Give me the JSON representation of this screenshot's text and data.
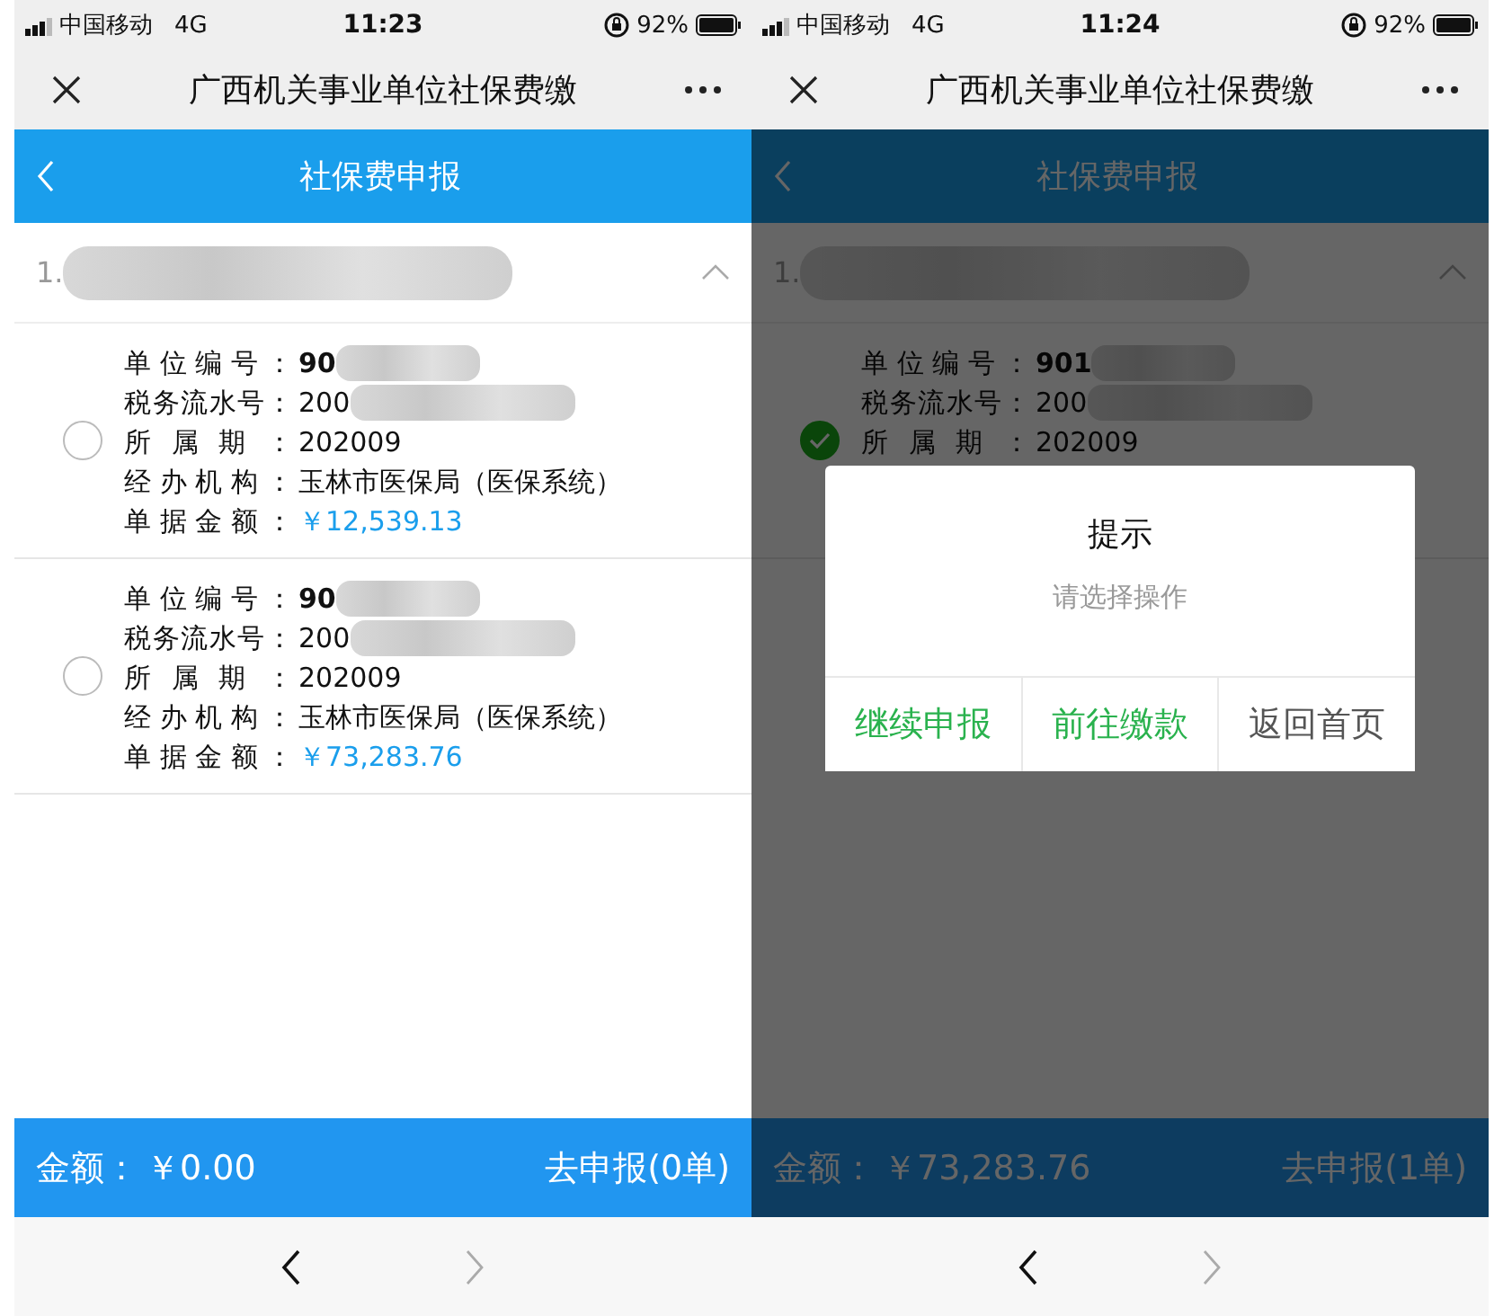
{
  "screens": [
    {
      "status_bar": {
        "carrier": "中国移动",
        "network": "4G",
        "time": "11:23",
        "battery": "92%"
      },
      "browser_bar": {
        "title": "广西机关事业单位社保费缴"
      },
      "header": {
        "title": "社保费申报"
      },
      "group": {
        "title": "1.",
        "redacted": true,
        "expanded": true
      },
      "items": [
        {
          "selected": false,
          "fields": [
            {
              "label": "单位编号：",
              "value": "90",
              "kind": "id",
              "redacted": true
            },
            {
              "label": "税务流水号：",
              "value": "200",
              "kind": "serial",
              "redacted": true
            },
            {
              "label": "所属期：",
              "value": "202009",
              "kind": "text",
              "redacted": false
            },
            {
              "label": "经办机构：",
              "value": "玉林市医保局（医保系统）",
              "kind": "text",
              "redacted": false
            },
            {
              "label": "单据金额：",
              "value": "￥12,539.13",
              "kind": "amount",
              "redacted": false
            }
          ]
        },
        {
          "selected": false,
          "fields": [
            {
              "label": "单位编号：",
              "value": "90",
              "kind": "id",
              "redacted": true
            },
            {
              "label": "税务流水号：",
              "value": "200",
              "kind": "serial",
              "redacted": true
            },
            {
              "label": "所属期：",
              "value": "202009",
              "kind": "text",
              "redacted": false
            },
            {
              "label": "经办机构：",
              "value": "玉林市医保局（医保系统）",
              "kind": "text",
              "redacted": false
            },
            {
              "label": "单据金额：",
              "value": "￥73,283.76",
              "kind": "amount",
              "redacted": false
            }
          ]
        }
      ],
      "footer": {
        "amount_label": "金额：",
        "amount": "￥0.00",
        "action": "去申报(0单)"
      },
      "browser_nav": {
        "back_enabled": true,
        "forward_enabled": false
      }
    },
    {
      "status_bar": {
        "carrier": "中国移动",
        "network": "4G",
        "time": "11:24",
        "battery": "92%"
      },
      "browser_bar": {
        "title": "广西机关事业单位社保费缴"
      },
      "header": {
        "title": "社保费申报"
      },
      "group": {
        "title": "1.",
        "redacted": true,
        "expanded": true
      },
      "items": [
        {
          "selected": true,
          "fields": [
            {
              "label": "单位编号：",
              "value": "901",
              "kind": "id",
              "redacted": true
            },
            {
              "label": "税务流水号：",
              "value": "200",
              "kind": "serial",
              "redacted": true
            },
            {
              "label": "所属期：",
              "value": "202009",
              "kind": "text",
              "redacted": false
            }
          ]
        }
      ],
      "footer": {
        "amount_label": "金额：",
        "amount": "￥73,283.76",
        "action": "去申报(1单)"
      },
      "dialog": {
        "title": "提示",
        "message": "请选择操作",
        "buttons": [
          {
            "label": "继续申报",
            "kind": "primary"
          },
          {
            "label": "前往缴款",
            "kind": "primary"
          },
          {
            "label": "返回首页",
            "kind": "default"
          }
        ]
      },
      "browser_nav": {
        "back_enabled": true,
        "forward_enabled": false
      }
    }
  ]
}
